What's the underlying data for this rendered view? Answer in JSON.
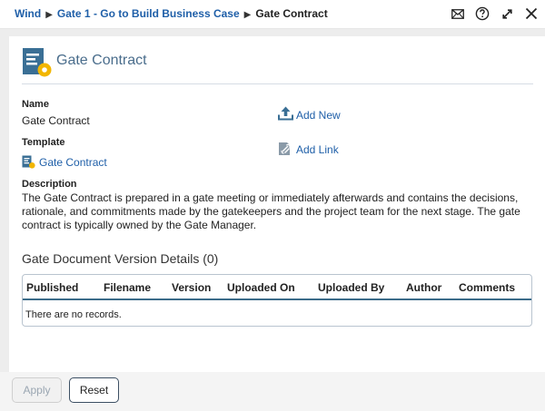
{
  "breadcrumb": {
    "items": [
      "Wind",
      "Gate 1 - Go to Build Business Case"
    ],
    "current": "Gate Contract",
    "separator": "▶"
  },
  "window_icons": [
    "mail-icon",
    "help-icon",
    "expand-icon",
    "close-icon"
  ],
  "header": {
    "title": "Gate Contract"
  },
  "fields": {
    "name_label": "Name",
    "name_value": "Gate Contract",
    "template_label": "Template",
    "template_value": "Gate Contract",
    "description_label": "Description",
    "description_value": "The Gate Contract is prepared in a gate meeting or immediately afterwards and contains the decisions, rationale, and commitments made by the gatekeepers and the project team for the next stage. The gate contract is typically owned by the Gate Manager."
  },
  "actions": {
    "add_new": "Add New",
    "add_link": "Add Link"
  },
  "table": {
    "title": "Gate Document Version Details (0)",
    "columns": [
      "Published",
      "Filename",
      "Version",
      "Uploaded On",
      "Uploaded By",
      "Author",
      "Comments"
    ],
    "empty_text": "There are no records."
  },
  "footer": {
    "apply": "Apply",
    "reset": "Reset"
  },
  "colors": {
    "link": "#1f5fa8",
    "icon_blue": "#3a6f95",
    "icon_yellow": "#f2b600",
    "table_rule": "#3b6c8a"
  }
}
